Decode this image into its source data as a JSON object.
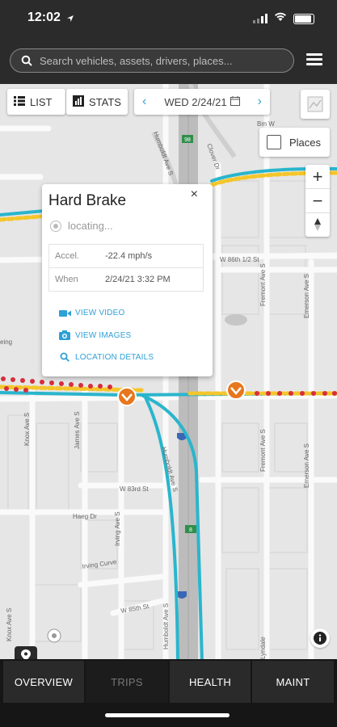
{
  "status_bar": {
    "time": "12:02"
  },
  "search": {
    "placeholder": "Search vehicles, assets, drivers, places..."
  },
  "toolbar": {
    "list_label": "LIST",
    "stats_label": "STATS",
    "date": "WED 2/24/21"
  },
  "places": {
    "label": "Places",
    "checked": false
  },
  "zoom": {
    "in": "+",
    "out": "−"
  },
  "popup": {
    "title": "Hard Brake",
    "close": "×",
    "locating": "locating...",
    "rows": [
      {
        "key": "Accel.",
        "value": "-22.4 mph/s"
      },
      {
        "key": "When",
        "value": "2/24/21 3:32 PM"
      }
    ],
    "actions": {
      "video": "VIEW VIDEO",
      "images": "VIEW IMAGES",
      "location": "LOCATION DETAILS"
    }
  },
  "map": {
    "streets": {
      "w86th": "W 86th 1/2 St",
      "w83rd": "W 83rd St",
      "haeg": "Haeg Dr",
      "irving_curve": "Irving Curve",
      "w85th": "W 85th St",
      "knox": "Knox Ave S",
      "james": "James Ave S",
      "irving": "Irving Ave S",
      "humboldt": "Humboldt Ave S",
      "fremont": "Fremont Ave S",
      "emerson": "Emerson Ave S",
      "clover": "Clover Dr",
      "lyndale": "Lyndale",
      "bm": "Bm W",
      "eing": "eing"
    },
    "shields": {
      "i35w": "35W",
      "exit98": "98",
      "exit8": "8"
    },
    "colors": {
      "route_blue": "#2ab5cc",
      "route_yellow": "#f5c62a",
      "route_red": "#d62e3c",
      "event_orange": "#e8761c"
    }
  },
  "tabs": {
    "overview": "OVERVIEW",
    "trips": "TRIPS",
    "health": "HEALTH",
    "maint": "MAINT"
  }
}
